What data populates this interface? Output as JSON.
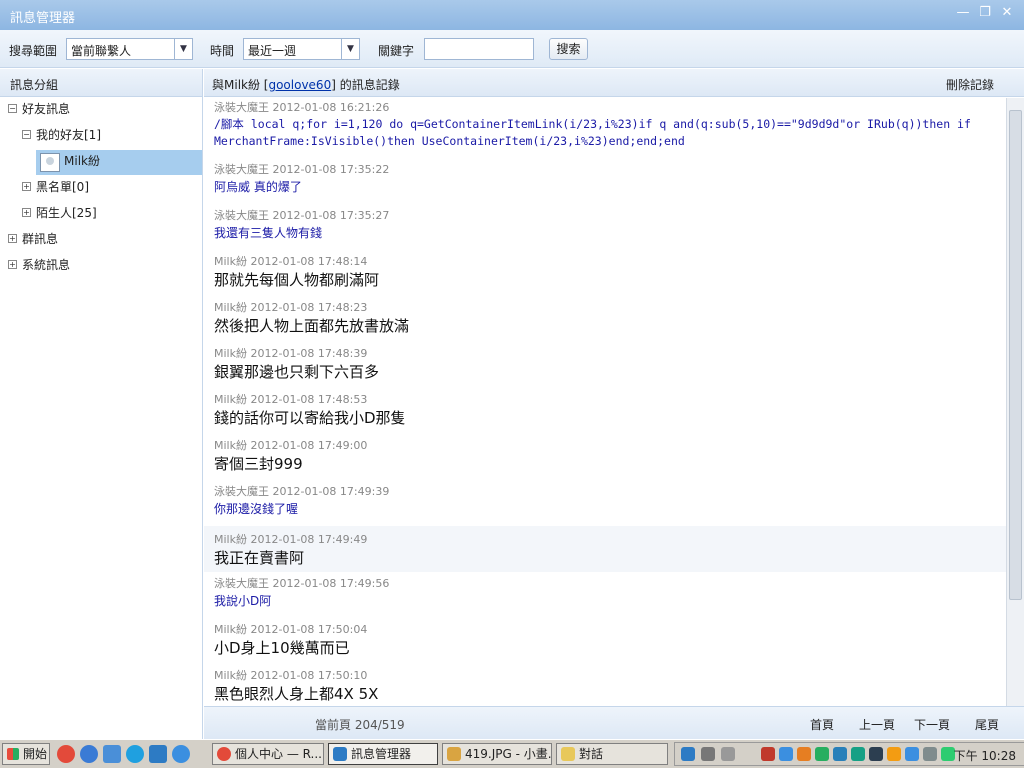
{
  "window": {
    "title": "訊息管理器"
  },
  "toolbar": {
    "scope_label": "搜尋範圍",
    "scope_value": "當前聯繫人",
    "time_label": "時間",
    "time_value": "最近一週",
    "keyword_label": "關鍵字",
    "keyword_value": "",
    "search_label": "搜索"
  },
  "left": {
    "header": "訊息分組",
    "items": [
      "好友訊息",
      "我的好友[1]",
      "Milk紛",
      "黑名單[0]",
      "陌生人[25]",
      "群訊息",
      "系統訊息"
    ]
  },
  "right": {
    "header_pre": "與Milk紛 [",
    "header_link": "goolove60",
    "header_post": "] 的訊息記錄",
    "delete_label": "刪除記錄"
  },
  "messages": [
    {
      "sender": "泳裝大魔王",
      "time": "2012-01-08 16:21:26",
      "lines": [
        "/腳本 local q;for i=1,120 do q=GetContainerItemLink(i/23,i%23)if q and(q:sub(5,10)==\"9d9d9d\"or IRub(q))then if",
        "MerchantFrame:IsVisible()then UseContainerItem(i/23,i%23)end;end;end"
      ]
    },
    {
      "sender": "泳裝大魔王",
      "time": "2012-01-08 17:35:22",
      "lines": [
        "阿烏威  真的爆了"
      ]
    },
    {
      "sender": "泳裝大魔王",
      "time": "2012-01-08 17:35:27",
      "lines": [
        "我還有三隻人物有錢"
      ]
    },
    {
      "sender": "Milk紛",
      "time": "2012-01-08 17:48:14",
      "lines": [
        "那就先每個人物都刷滿阿"
      ]
    },
    {
      "sender": "Milk紛",
      "time": "2012-01-08 17:48:23",
      "lines": [
        "然後把人物上面都先放書放滿"
      ]
    },
    {
      "sender": "Milk紛",
      "time": "2012-01-08 17:48:39",
      "lines": [
        "銀翼那邊也只剩下六百多"
      ]
    },
    {
      "sender": "Milk紛",
      "time": "2012-01-08 17:48:53",
      "lines": [
        "錢的話你可以寄給我小D那隻"
      ]
    },
    {
      "sender": "Milk紛",
      "time": "2012-01-08 17:49:00",
      "lines": [
        "寄個三封999"
      ]
    },
    {
      "sender": "泳裝大魔王",
      "time": "2012-01-08 17:49:39",
      "lines": [
        "你那邊沒錢了喔"
      ]
    },
    {
      "sender": "Milk紛",
      "time": "2012-01-08 17:49:49",
      "lines": [
        "我正在賣書阿"
      ]
    },
    {
      "sender": "泳裝大魔王",
      "time": "2012-01-08 17:49:56",
      "lines": [
        "我說小D阿"
      ]
    },
    {
      "sender": "Milk紛",
      "time": "2012-01-08 17:50:04",
      "lines": [
        "小D身上10幾萬而已"
      ]
    },
    {
      "sender": "Milk紛",
      "time": "2012-01-08 17:50:10",
      "lines": [
        "黑色眼烈人身上都4X 5X"
      ]
    }
  ],
  "pager": {
    "current_page": "當前頁 204/519",
    "first": "首頁",
    "prev": "上一頁",
    "next": "下一頁",
    "last": "尾頁"
  },
  "taskbar": {
    "start_label": "開始",
    "tasks": [
      "個人中心 — R...",
      "訊息管理器",
      "419.JPG - 小畫...",
      "對話"
    ],
    "clock": "下午 10:28"
  },
  "colors": {
    "accent": "#8db6e2",
    "selection": "#a6cdee",
    "message_blue": "#1a1aa6"
  }
}
